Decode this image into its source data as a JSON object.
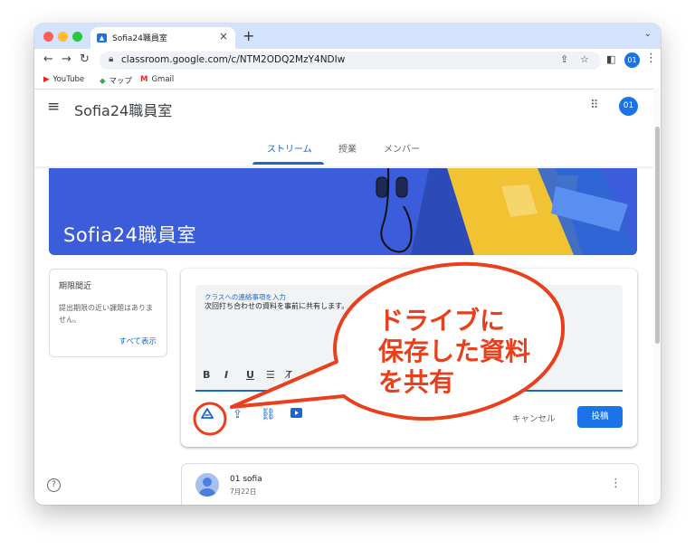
{
  "browser": {
    "tab_title": "Sofia24職員室",
    "url": "classroom.google.com/c/NTM2ODQ2MzY4NDIw",
    "profile_badge": "01",
    "bookmarks": [
      "YouTube",
      "マップ",
      "Gmail"
    ]
  },
  "classroom": {
    "class_name": "Sofia24職員室",
    "avatar": "01",
    "tabs": [
      "ストリーム",
      "授業",
      "メンバー"
    ],
    "active_tab": "ストリーム",
    "banner_title": "Sofia24職員室"
  },
  "upcoming": {
    "title": "期限間近",
    "empty_text": "提出期限の近い課題はありません。",
    "view_all": "すべて表示"
  },
  "composer": {
    "label": "クラスへの連絡事項を入力",
    "value": "次回打ち合わせの資料を事前に共有します。",
    "format_buttons": [
      "B",
      "I",
      "U",
      "☰",
      "T̸"
    ],
    "cancel": "キャンセル",
    "post": "投稿"
  },
  "post": {
    "author": "01 sofia",
    "date": "7月22日"
  },
  "annotation": {
    "lines": [
      "ドライブに",
      "保存した資料",
      "を共有"
    ],
    "color": "#e8401c"
  },
  "colors": {
    "accent": "#1967d2",
    "banner": "#3b5ddb",
    "tabstrip": "#d3e3fd"
  }
}
